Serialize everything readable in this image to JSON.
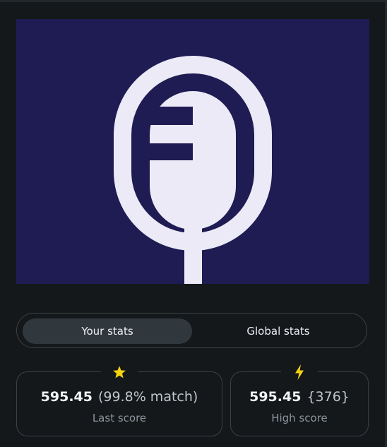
{
  "icons": {
    "cover": "microphone-e-logo",
    "last_score_badge": "star-icon",
    "high_score_badge": "lightning-bolt-icon"
  },
  "colors": {
    "cover_background": "#1e1c52",
    "logo_fill": "#eceaf6",
    "badge_yellow": "#f5d311",
    "page_background": "#14181b"
  },
  "tabs": [
    {
      "label": "Your stats",
      "active": true
    },
    {
      "label": "Global stats",
      "active": false
    }
  ],
  "last_score": {
    "value": "595.45",
    "detail": "(99.8% match)",
    "label": "Last score"
  },
  "high_score": {
    "value": "595.45",
    "detail": "{376}",
    "label": "High score"
  }
}
